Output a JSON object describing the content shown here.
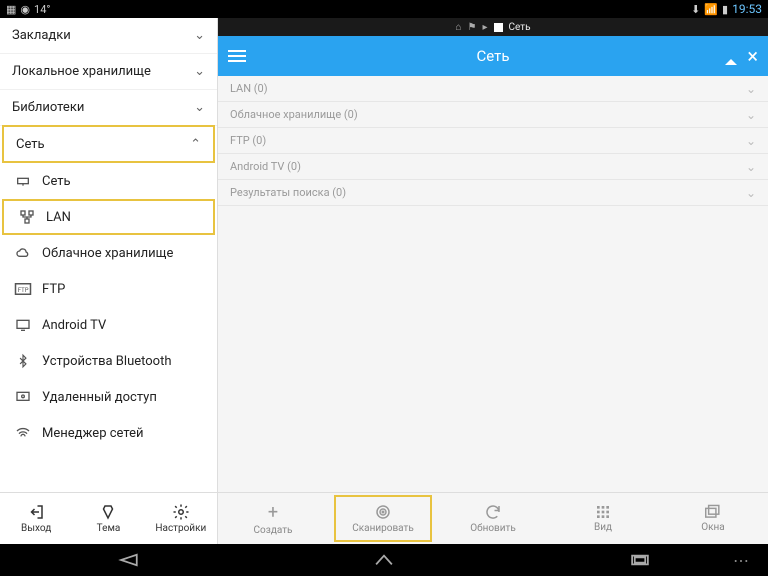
{
  "statusbar": {
    "temp": "14°",
    "clock": "19:53"
  },
  "crumb": {
    "label": "Сеть"
  },
  "header": {
    "title": "Сеть"
  },
  "sidebar": {
    "sections": [
      {
        "label": "Закладки"
      },
      {
        "label": "Локальное хранилище"
      },
      {
        "label": "Библиотеки"
      },
      {
        "label": "Сеть"
      }
    ],
    "network_items": [
      {
        "label": "Сеть"
      },
      {
        "label": "LAN"
      },
      {
        "label": "Облачное хранилище"
      },
      {
        "label": "FTP"
      },
      {
        "label": "Android TV"
      },
      {
        "label": "Устройства Bluetooth"
      },
      {
        "label": "Удаленный доступ"
      },
      {
        "label": "Менеджер сетей"
      }
    ],
    "bottom": [
      {
        "label": "Выход"
      },
      {
        "label": "Тема"
      },
      {
        "label": "Настройки"
      }
    ]
  },
  "list": [
    {
      "label": "LAN (0)"
    },
    {
      "label": "Облачное хранилище (0)"
    },
    {
      "label": "FTP (0)"
    },
    {
      "label": "Android TV (0)"
    },
    {
      "label": "Результаты поиска (0)"
    }
  ],
  "toolbar": [
    {
      "label": "Создать"
    },
    {
      "label": "Сканировать"
    },
    {
      "label": "Обновить"
    },
    {
      "label": "Вид"
    },
    {
      "label": "Окна"
    }
  ]
}
